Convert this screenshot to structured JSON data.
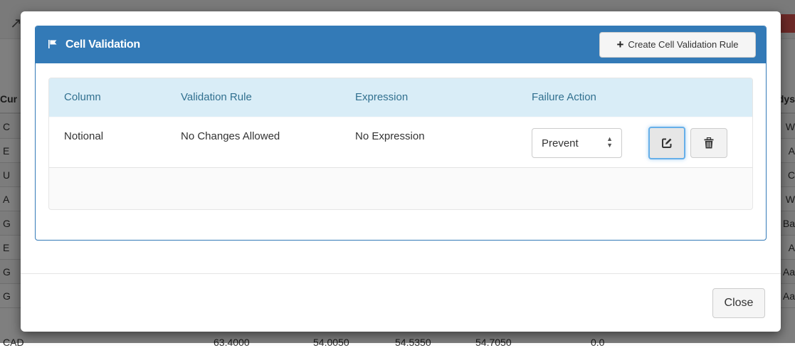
{
  "background": {
    "header_left": "Cur",
    "header_right": "dys",
    "rows": [
      {
        "l": "C",
        "r": "W"
      },
      {
        "l": "E",
        "r": "A"
      },
      {
        "l": "U",
        "r": "C"
      },
      {
        "l": "A",
        "r": "W"
      },
      {
        "l": "G",
        "r": "Ba"
      },
      {
        "l": "E",
        "r": "A"
      },
      {
        "l": "G",
        "r": "Aa"
      },
      {
        "l": "G",
        "r": "Aa"
      }
    ],
    "last_row": [
      "CAD",
      "",
      "63.4000",
      "54.0050",
      "54.5350",
      "54.7050",
      "0.0"
    ]
  },
  "panel": {
    "title": "Cell Validation",
    "create_button": "Create Cell Validation Rule"
  },
  "table": {
    "columns": [
      "Column",
      "Validation Rule",
      "Expression",
      "Failure Action"
    ],
    "rows": [
      {
        "column": "Notional",
        "validation_rule": "No Changes Allowed",
        "expression": "No Expression",
        "failure_action": "Prevent"
      }
    ]
  },
  "footer": {
    "close_button": "Close"
  },
  "colors": {
    "primary": "#337ab7",
    "table_header_bg": "#d9edf7",
    "table_header_text": "#31708f",
    "focus": "#66afe9"
  }
}
